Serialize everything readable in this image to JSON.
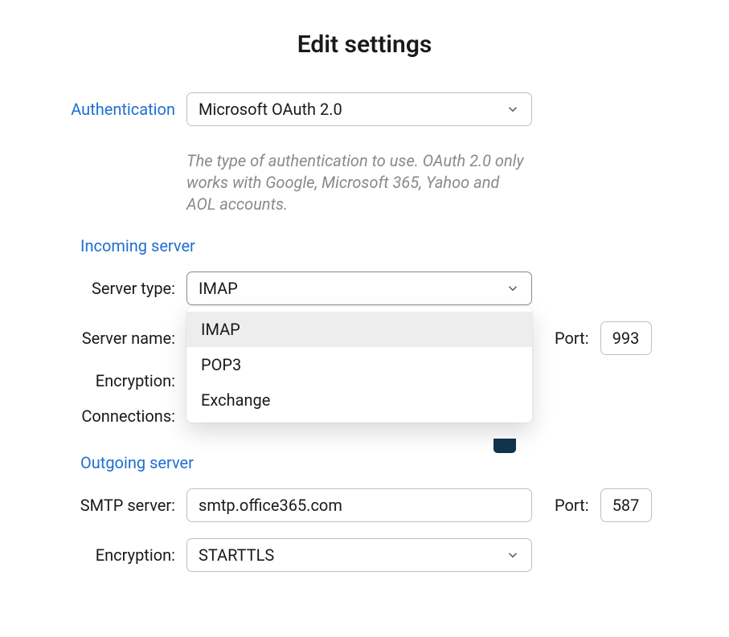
{
  "title": "Edit settings",
  "auth": {
    "label": "Authentication",
    "value": "Microsoft OAuth 2.0",
    "hint": "The type of authentication to use. OAuth 2.0 only works with Google, Microsoft 365, Yahoo and AOL accounts."
  },
  "incoming": {
    "header": "Incoming server",
    "server_type_label": "Server type:",
    "server_type_value": "IMAP",
    "server_type_options": [
      "IMAP",
      "POP3",
      "Exchange"
    ],
    "server_name_label": "Server name:",
    "server_name_value": "",
    "encryption_label": "Encryption:",
    "connections_label": "Connections:",
    "port_label": "Port:",
    "port_value": "993"
  },
  "outgoing": {
    "header": "Outgoing server",
    "smtp_label": "SMTP server:",
    "smtp_value": "smtp.office365.com",
    "port_label": "Port:",
    "port_value": "587",
    "encryption_label": "Encryption:",
    "encryption_value": "STARTTLS"
  }
}
